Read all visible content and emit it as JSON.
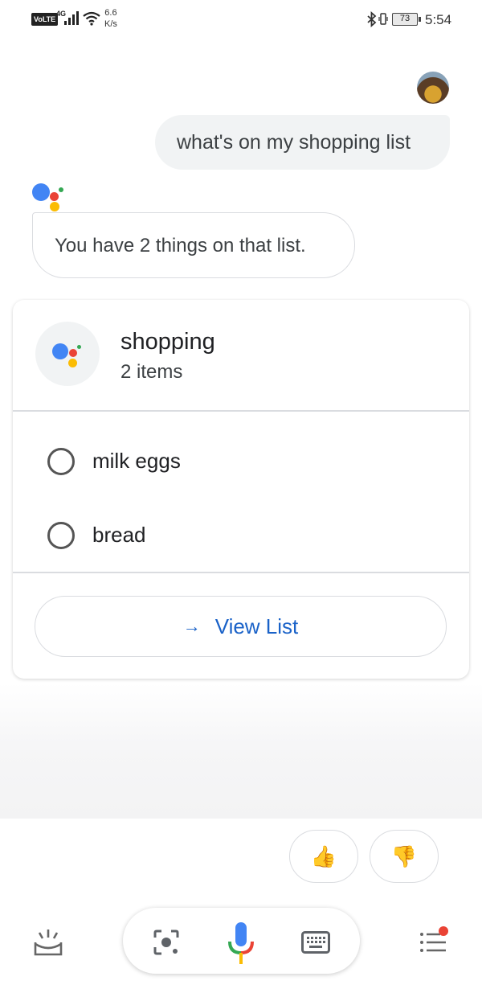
{
  "status_bar": {
    "volte": "VoLTE",
    "network": "4G",
    "speed_value": "6.6",
    "speed_unit": "K/s",
    "battery": "73",
    "time": "5:54"
  },
  "conversation": {
    "user_query": "what's on my shopping list",
    "assistant_reply": "You have 2 things on that list."
  },
  "list_card": {
    "title": "shopping",
    "count": "2 items",
    "items": [
      {
        "label": "milk eggs",
        "checked": false
      },
      {
        "label": "bread",
        "checked": false
      }
    ],
    "view_button": "View List",
    "view_arrow": "→"
  },
  "feedback": {
    "thumbs_up": "👍",
    "thumbs_down": "👎"
  },
  "bottom_bar": {
    "icons": [
      "updates-icon",
      "lens-icon",
      "mic-icon",
      "keyboard-icon",
      "explore-icon"
    ],
    "notification_dot": true
  },
  "colors": {
    "google_blue": "#4285f4",
    "google_red": "#ea4335",
    "google_yellow": "#fbbc04",
    "google_green": "#34a853",
    "link_blue": "#1a62c8"
  }
}
